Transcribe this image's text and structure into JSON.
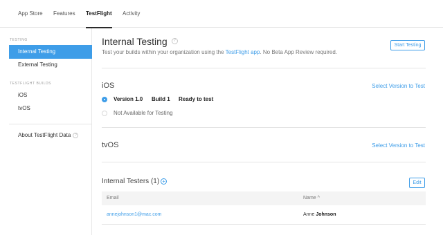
{
  "nav": {
    "tabs": [
      {
        "label": "App Store"
      },
      {
        "label": "Features"
      },
      {
        "label": "TestFlight"
      },
      {
        "label": "Activity"
      }
    ],
    "active_tab": "TestFlight"
  },
  "sidebar": {
    "testing_header": "TESTING",
    "testing_items": [
      {
        "label": "Internal Testing"
      },
      {
        "label": "External Testing"
      }
    ],
    "builds_header": "TESTFLIGHT BUILDS",
    "build_items": [
      {
        "label": "iOS"
      },
      {
        "label": "tvOS"
      }
    ],
    "about_label": "About TestFlight Data",
    "help_glyph": "?"
  },
  "main": {
    "title": "Internal Testing",
    "help_glyph": "?",
    "subtitle_before": "Test your builds within your organization using the ",
    "subtitle_link": "TestFlight app",
    "subtitle_after": ". No Beta App Review required.",
    "start_button": "Start Testing",
    "ios": {
      "title": "iOS",
      "select_link": "Select Version to Test",
      "options": [
        {
          "version": "Version 1.0",
          "build": "Build 1",
          "status": "Ready to test",
          "selected": true
        },
        {
          "label": "Not Available for Testing",
          "selected": false
        }
      ]
    },
    "tvos": {
      "title": "tvOS",
      "select_link": "Select Version to Test"
    },
    "testers": {
      "title": "Internal Testers (1)",
      "add_glyph": "+",
      "edit_button": "Edit",
      "columns": {
        "email": "Email",
        "name": "Name ^"
      },
      "rows": [
        {
          "email": "annejohnson1@mac.com",
          "first_name": "Anne",
          "last_name": "Johnson"
        }
      ]
    }
  },
  "colors": {
    "accent": "#3e9de8",
    "divider": "#e3e3e3"
  }
}
